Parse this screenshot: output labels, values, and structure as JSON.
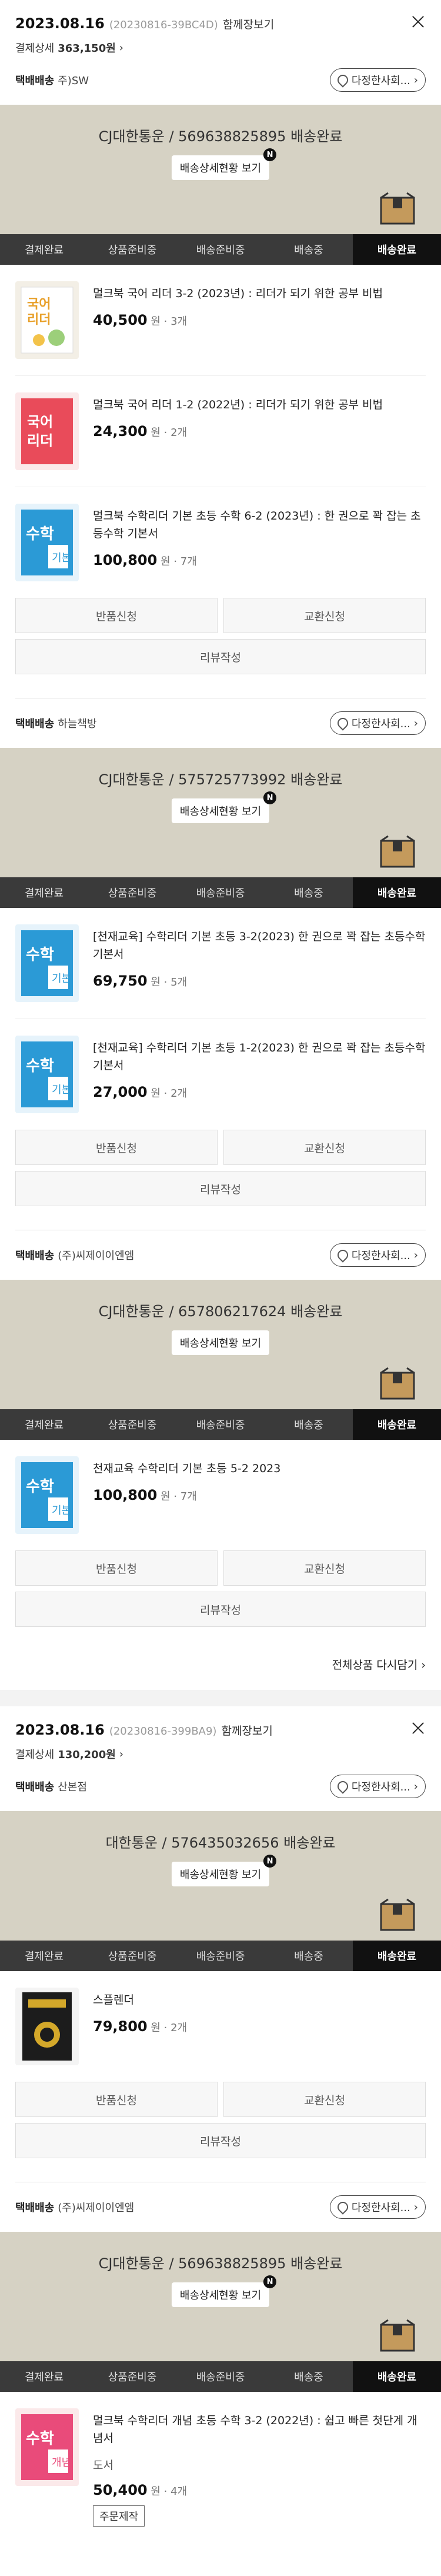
{
  "common": {
    "track_pill": "다정한사회...",
    "detail_btn": "배송상세현황 보기",
    "n": "N",
    "steps": [
      "결제완료",
      "상품준비중",
      "배송준비중",
      "배송중",
      "배송완료"
    ],
    "return": "반품신청",
    "exchange": "교환신청",
    "review": "리뷰작성",
    "won": "원",
    "seller_prefix": "택배배송"
  },
  "order1": {
    "date": "2023.08.16",
    "id": "(20230816-39BC4D)",
    "together": "함께장보기",
    "pay_label": "결제상세",
    "pay_amount": "363,150원",
    "groups": [
      {
        "seller": "주)SW",
        "carrier": "CJ대한통운 / 569638825895 배송완료",
        "items": [
          {
            "title": "멀크북 국어 리더 3-2 (2023년) : 리더가 되기 위한 공부 비법",
            "price": "40,500",
            "qty": "· 3개"
          },
          {
            "title": "멀크북 국어 리더 1-2 (2022년) : 리더가 되기 위한 공부 비법",
            "price": "24,300",
            "qty": "· 2개"
          },
          {
            "title": "멀크북 수학리더 기본 초등 수학 6-2 (2023년) : 한 권으로 꽉 잡는 초등수학 기본서",
            "price": "100,800",
            "qty": "· 7개"
          }
        ]
      },
      {
        "seller": "하늘책방",
        "carrier": "CJ대한통운 / 575725773992 배송완료",
        "items": [
          {
            "title": "[천재교육] 수학리더 기본 초등 3-2(2023) 한 권으로 꽉 잡는 초등수학 기본서",
            "price": "69,750",
            "qty": "· 5개"
          },
          {
            "title": "[천재교육] 수학리더 기본 초등 1-2(2023) 한 권으로 꽉 잡는 초등수학 기본서",
            "price": "27,000",
            "qty": "· 2개"
          }
        ]
      },
      {
        "seller": "(주)씨제이이엔엠",
        "carrier": "CJ대한통운 / 657806217624 배송완료",
        "items": [
          {
            "title": "천재교육 수학리더 기본 초등 5-2 2023",
            "price": "100,800",
            "qty": "· 7개"
          }
        ]
      }
    ],
    "see_all": "전체상품 다시담기"
  },
  "order2": {
    "date": "2023.08.16",
    "id": "(20230816-399BA9)",
    "together": "함께장보기",
    "pay_label": "결제상세",
    "pay_amount": "130,200원",
    "groups": [
      {
        "seller": "산본점",
        "carrier": "대한통운 / 576435032656 배송완료",
        "items": [
          {
            "title": "스플렌더",
            "price": "79,800",
            "qty": "· 2개"
          }
        ]
      },
      {
        "seller": "(주)씨제이이엔엠",
        "carrier": "CJ대한통운 / 569638825895 배송완료",
        "items": [
          {
            "title": "멀크북 수학리더 개념 초등 수학 3-2 (2022년) : 쉽고 빠른 첫단계 개념서",
            "price": "50,400",
            "qty": "· 4개",
            "sub": "도서",
            "tag": "주문제작"
          }
        ]
      }
    ]
  }
}
